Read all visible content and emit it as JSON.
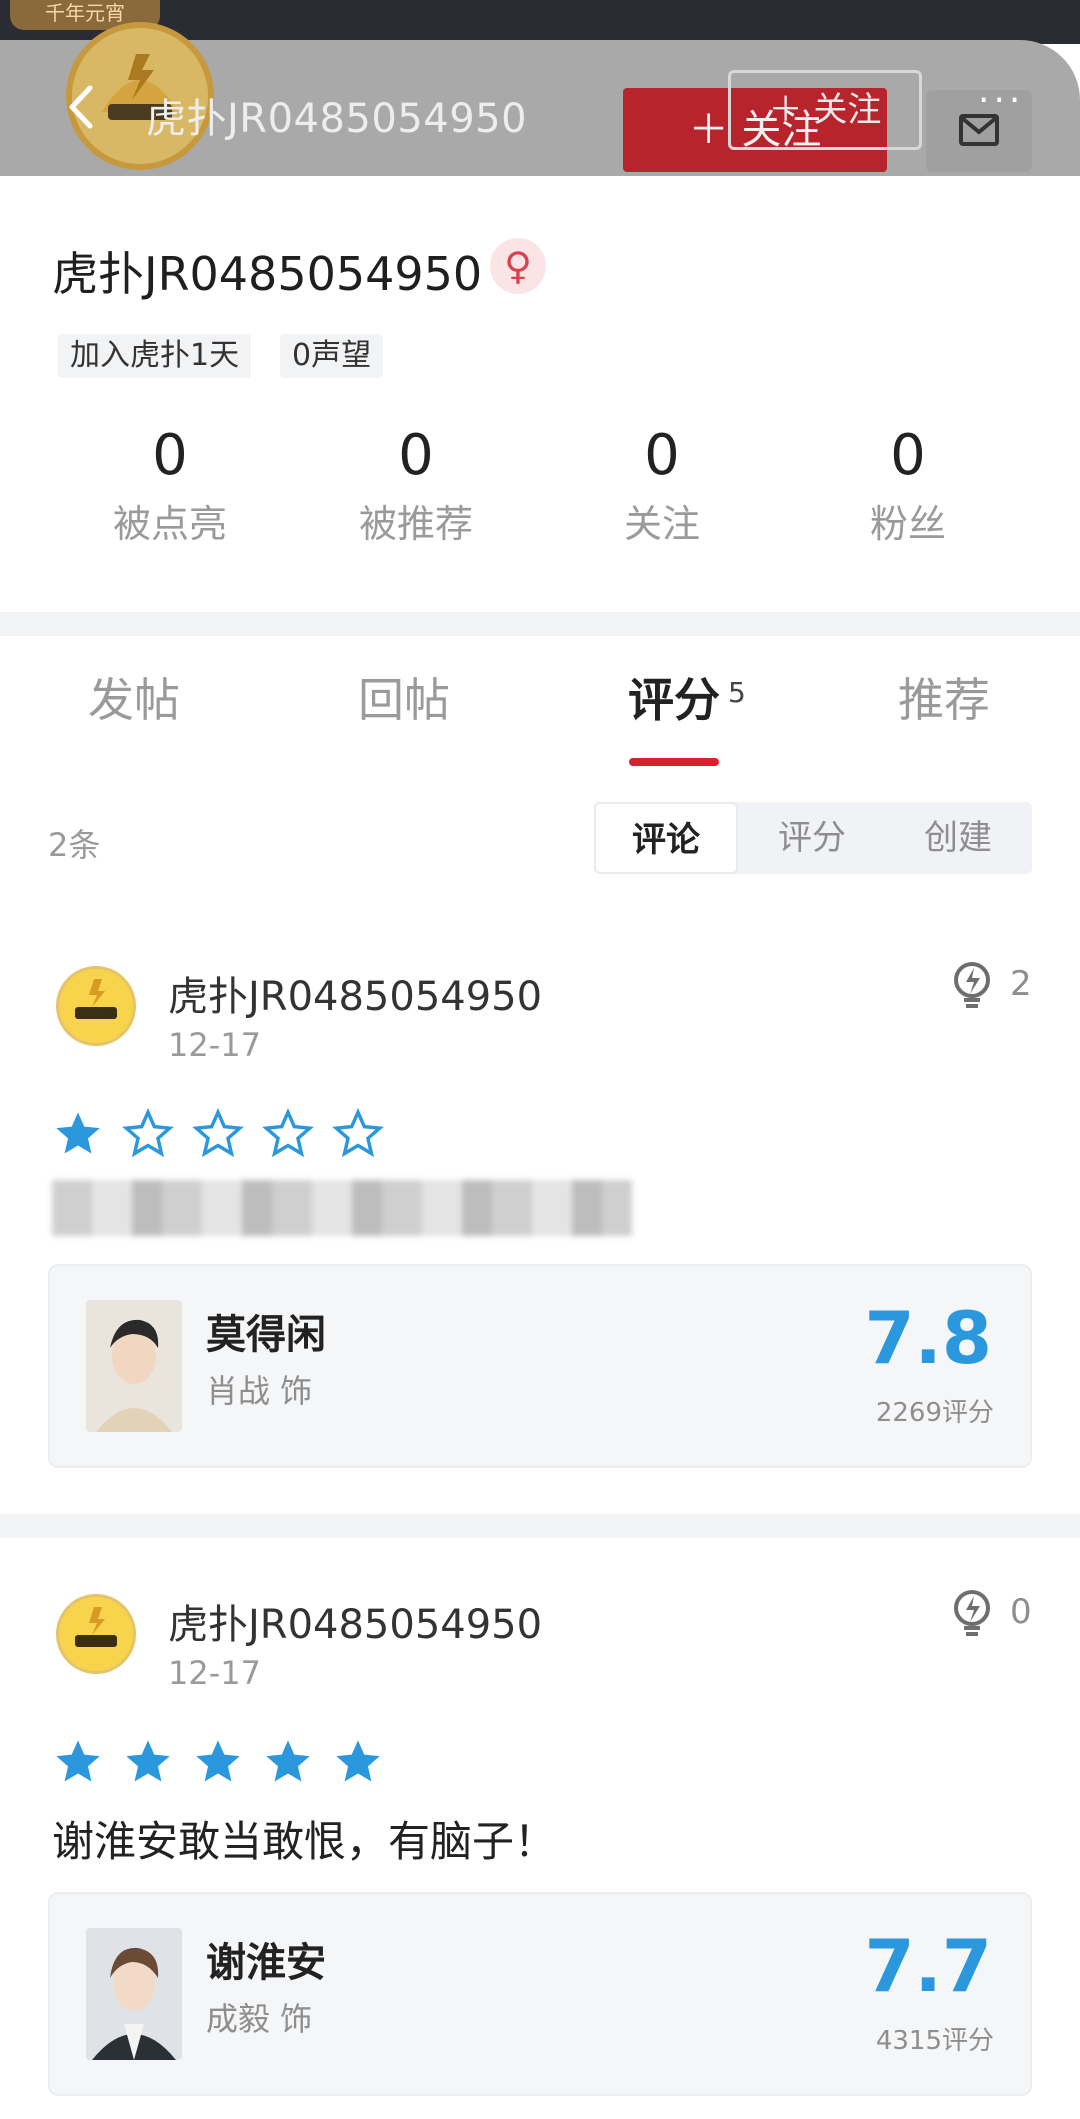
{
  "top_badge": "千年元宵",
  "header": {
    "back_icon": "chevron-left-icon",
    "title": "虎扑JR0485054950",
    "follow_label": "＋ 关注",
    "follow_ghost_label": "＋ 关注",
    "more_label": "···",
    "mail_icon": "mail-icon"
  },
  "profile": {
    "name": "虎扑JR0485054950",
    "gender_icon": "female-icon",
    "gender_symbol": "♀",
    "tags": [
      "加入虎扑1天",
      "0声望"
    ],
    "stats": [
      {
        "value": "0",
        "label": "被点亮"
      },
      {
        "value": "0",
        "label": "被推荐"
      },
      {
        "value": "0",
        "label": "关注"
      },
      {
        "value": "0",
        "label": "粉丝"
      }
    ]
  },
  "tabs": [
    {
      "label": "发帖"
    },
    {
      "label": "回帖"
    },
    {
      "label": "评分",
      "badge": "5"
    },
    {
      "label": "推荐"
    }
  ],
  "list": {
    "count_label": "2条",
    "segments": [
      "评论",
      "评分",
      "创建"
    ],
    "active_segment": "评论"
  },
  "reviews": [
    {
      "user": "虎扑JR0485054950",
      "date": "12-17",
      "lights": "2",
      "stars": 1,
      "text": "",
      "role": {
        "name": "莫得闲",
        "actor": "肖战 饰",
        "score": "7.8",
        "count": "2269评分"
      }
    },
    {
      "user": "虎扑JR0485054950",
      "date": "12-17",
      "lights": "0",
      "stars": 5,
      "text": "谢淮安敢当敢恨，有脑子！",
      "role": {
        "name": "谢淮安",
        "actor": "成毅 饰",
        "score": "7.7",
        "count": "4315评分"
      }
    }
  ],
  "colors": {
    "accent_red": "#d7232c",
    "star_blue": "#2b97dc",
    "score_blue": "#2b97dc"
  }
}
